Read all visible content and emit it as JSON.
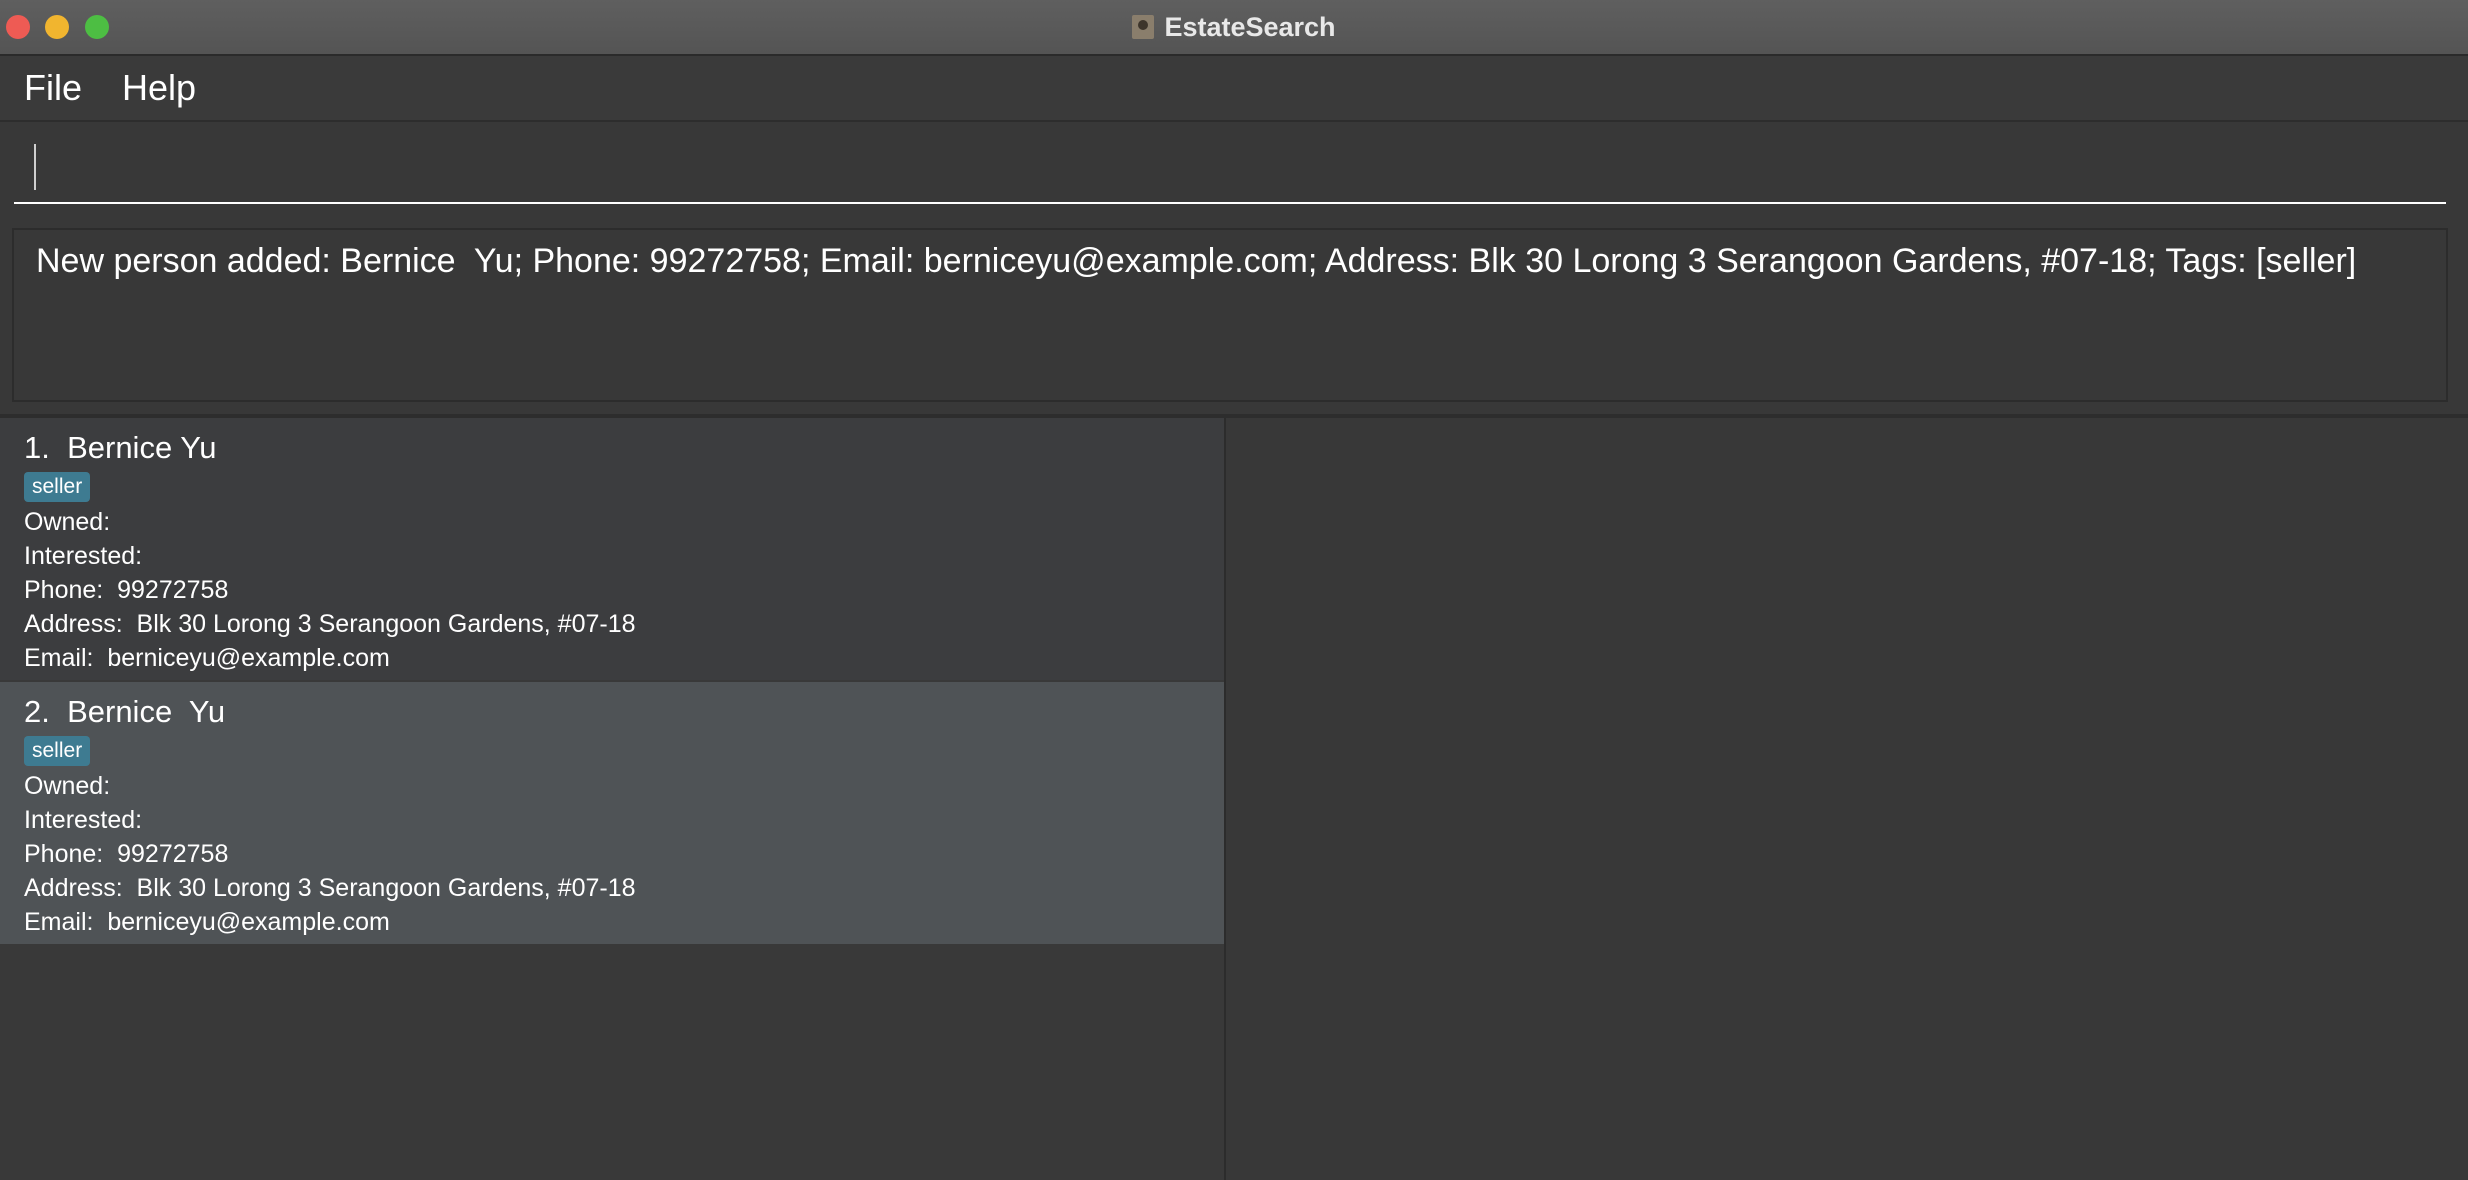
{
  "window": {
    "title": "EstateSearch"
  },
  "menu": {
    "items": [
      {
        "label": "File"
      },
      {
        "label": "Help"
      }
    ]
  },
  "command_box": {
    "value": ""
  },
  "result_display": {
    "text": "New person added: Bernice  Yu; Phone: 99272758; Email: berniceyu@example.com; Address: Blk 30 Lorong 3 Serangoon Gardens, #07-18; Tags: [seller]"
  },
  "persons": [
    {
      "index_name": "1.  Bernice Yu",
      "tag": "seller",
      "owned": "Owned:",
      "interested": "Interested:",
      "phone": "Phone:  99272758",
      "address": "Address:  Blk 30 Lorong 3 Serangoon Gardens, #07-18",
      "email": "Email:  berniceyu@example.com",
      "selected": false
    },
    {
      "index_name": "2.  Bernice  Yu",
      "tag": "seller",
      "owned": "Owned:",
      "interested": "Interested:",
      "phone": "Phone:  99272758",
      "address": "Address:  Blk 30 Lorong 3 Serangoon Gardens, #07-18",
      "email": "Email:  berniceyu@example.com",
      "selected": true
    }
  ],
  "colors": {
    "background": "#383838",
    "selected_card": "#4f5356",
    "tag": "#3e7b91"
  }
}
